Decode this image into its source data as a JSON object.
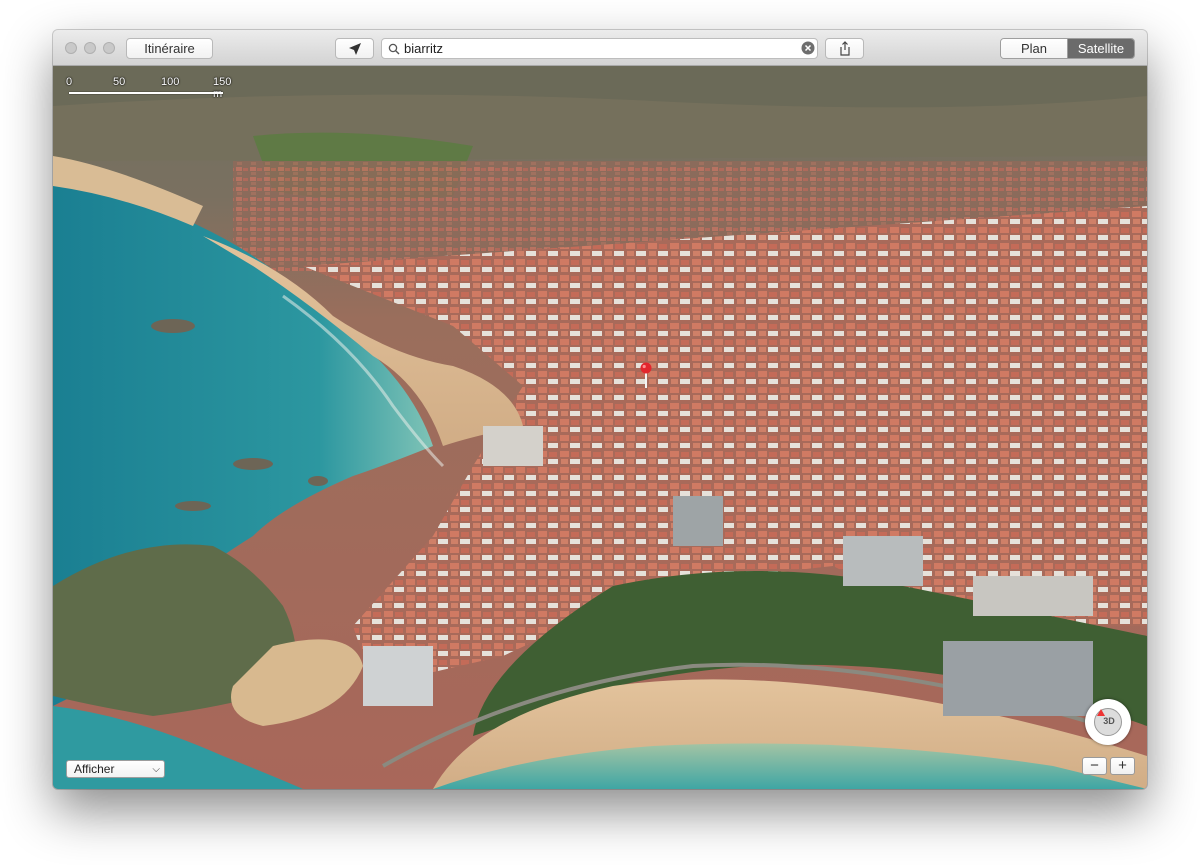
{
  "window": {
    "itinerary_label": "Itinéraire",
    "search_value": "biarritz",
    "view_modes": [
      "Plan",
      "Satellite"
    ],
    "active_view": "Satellite"
  },
  "map": {
    "scale_labels": [
      "0",
      "50",
      "100",
      "150 m"
    ],
    "display_menu_label": "Afficher",
    "compass_label": "3D",
    "zoom_out_label": "−",
    "zoom_in_label": "+"
  },
  "colors": {
    "ocean": "#1f8c9c",
    "shallow_water": "#66bcb5",
    "sand": "#ddb98d",
    "roofs": "#c7705c",
    "vegetation": "#4b6b37",
    "pin": "#e3262d"
  },
  "icons": [
    "location-arrow-icon",
    "search-icon",
    "clear-search-icon",
    "share-icon",
    "compass-icon",
    "location-pin-icon"
  ]
}
